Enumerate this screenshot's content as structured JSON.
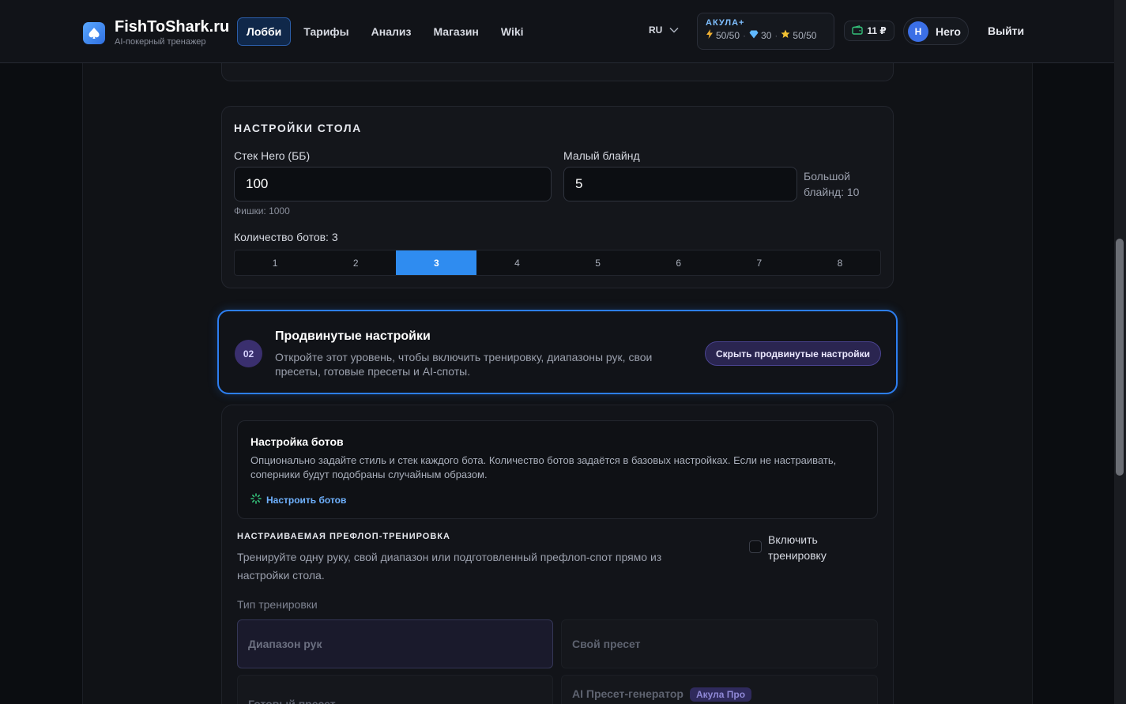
{
  "header": {
    "brand": "FishToShark.ru",
    "tagline": "AI-покерный тренажер",
    "nav": [
      {
        "label": "Лобби",
        "active": true
      },
      {
        "label": "Тарифы",
        "active": false
      },
      {
        "label": "Анализ",
        "active": false
      },
      {
        "label": "Магазин",
        "active": false
      },
      {
        "label": "Wiki",
        "active": false
      }
    ],
    "language": "RU",
    "plan": {
      "name": "АКУЛА+",
      "energy": "50/50",
      "gems": "30",
      "stars": "50/50"
    },
    "wallet": "11 ₽",
    "user": {
      "initial": "H",
      "name": "Hero"
    },
    "logout": "Выйти"
  },
  "table_settings": {
    "title": "НАСТРОЙКИ СТОЛА",
    "stack_label": "Стек Hero (ББ)",
    "stack_value": "100",
    "chips_hint": "Фишки: 1000",
    "small_blind_label": "Малый блайнд",
    "small_blind_value": "5",
    "big_blind_note": "Большой блайнд: 10",
    "bots_label": "Количество ботов: 3",
    "bot_options": [
      "1",
      "2",
      "3",
      "4",
      "5",
      "6",
      "7",
      "8"
    ],
    "selected_bots": "3"
  },
  "advanced": {
    "step": "02",
    "title": "Продвинутые настройки",
    "description": "Откройте этот уровень, чтобы включить тренировку, диапазоны рук, свои пресеты, готовые пресеты и AI-споты.",
    "toggle_button": "Скрыть продвинутые настройки"
  },
  "bot_config": {
    "title": "Настройка ботов",
    "description": "Опционально задайте стиль и стек каждого бота. Количество ботов задаётся в базовых настройках. Если не настраивать, соперники будут подобраны случайным образом.",
    "link": "Настроить ботов"
  },
  "training": {
    "title": "НАСТРАИВАЕМАЯ ПРЕФЛОП-ТРЕНИРОВКА",
    "description": "Тренируйте одну руку, свой диапазон или подготовленный префлоп-спот прямо из настройки стола.",
    "enable_label": "Включить тренировку",
    "enabled": false,
    "type_label": "Тип тренировки",
    "types": [
      {
        "label": "Диапазон рук",
        "selected": true
      },
      {
        "label": "Свой пресет",
        "selected": false
      },
      {
        "label": "Готовый пресет",
        "selected": false
      },
      {
        "label": "AI Пресет-генератор",
        "selected": false,
        "tag": "Акула Про"
      }
    ]
  },
  "colors": {
    "accent": "#2f8cf0",
    "advanced_border": "#2d7ef0",
    "link": "#6fb2ff",
    "plan_name": "#7fbfff"
  }
}
